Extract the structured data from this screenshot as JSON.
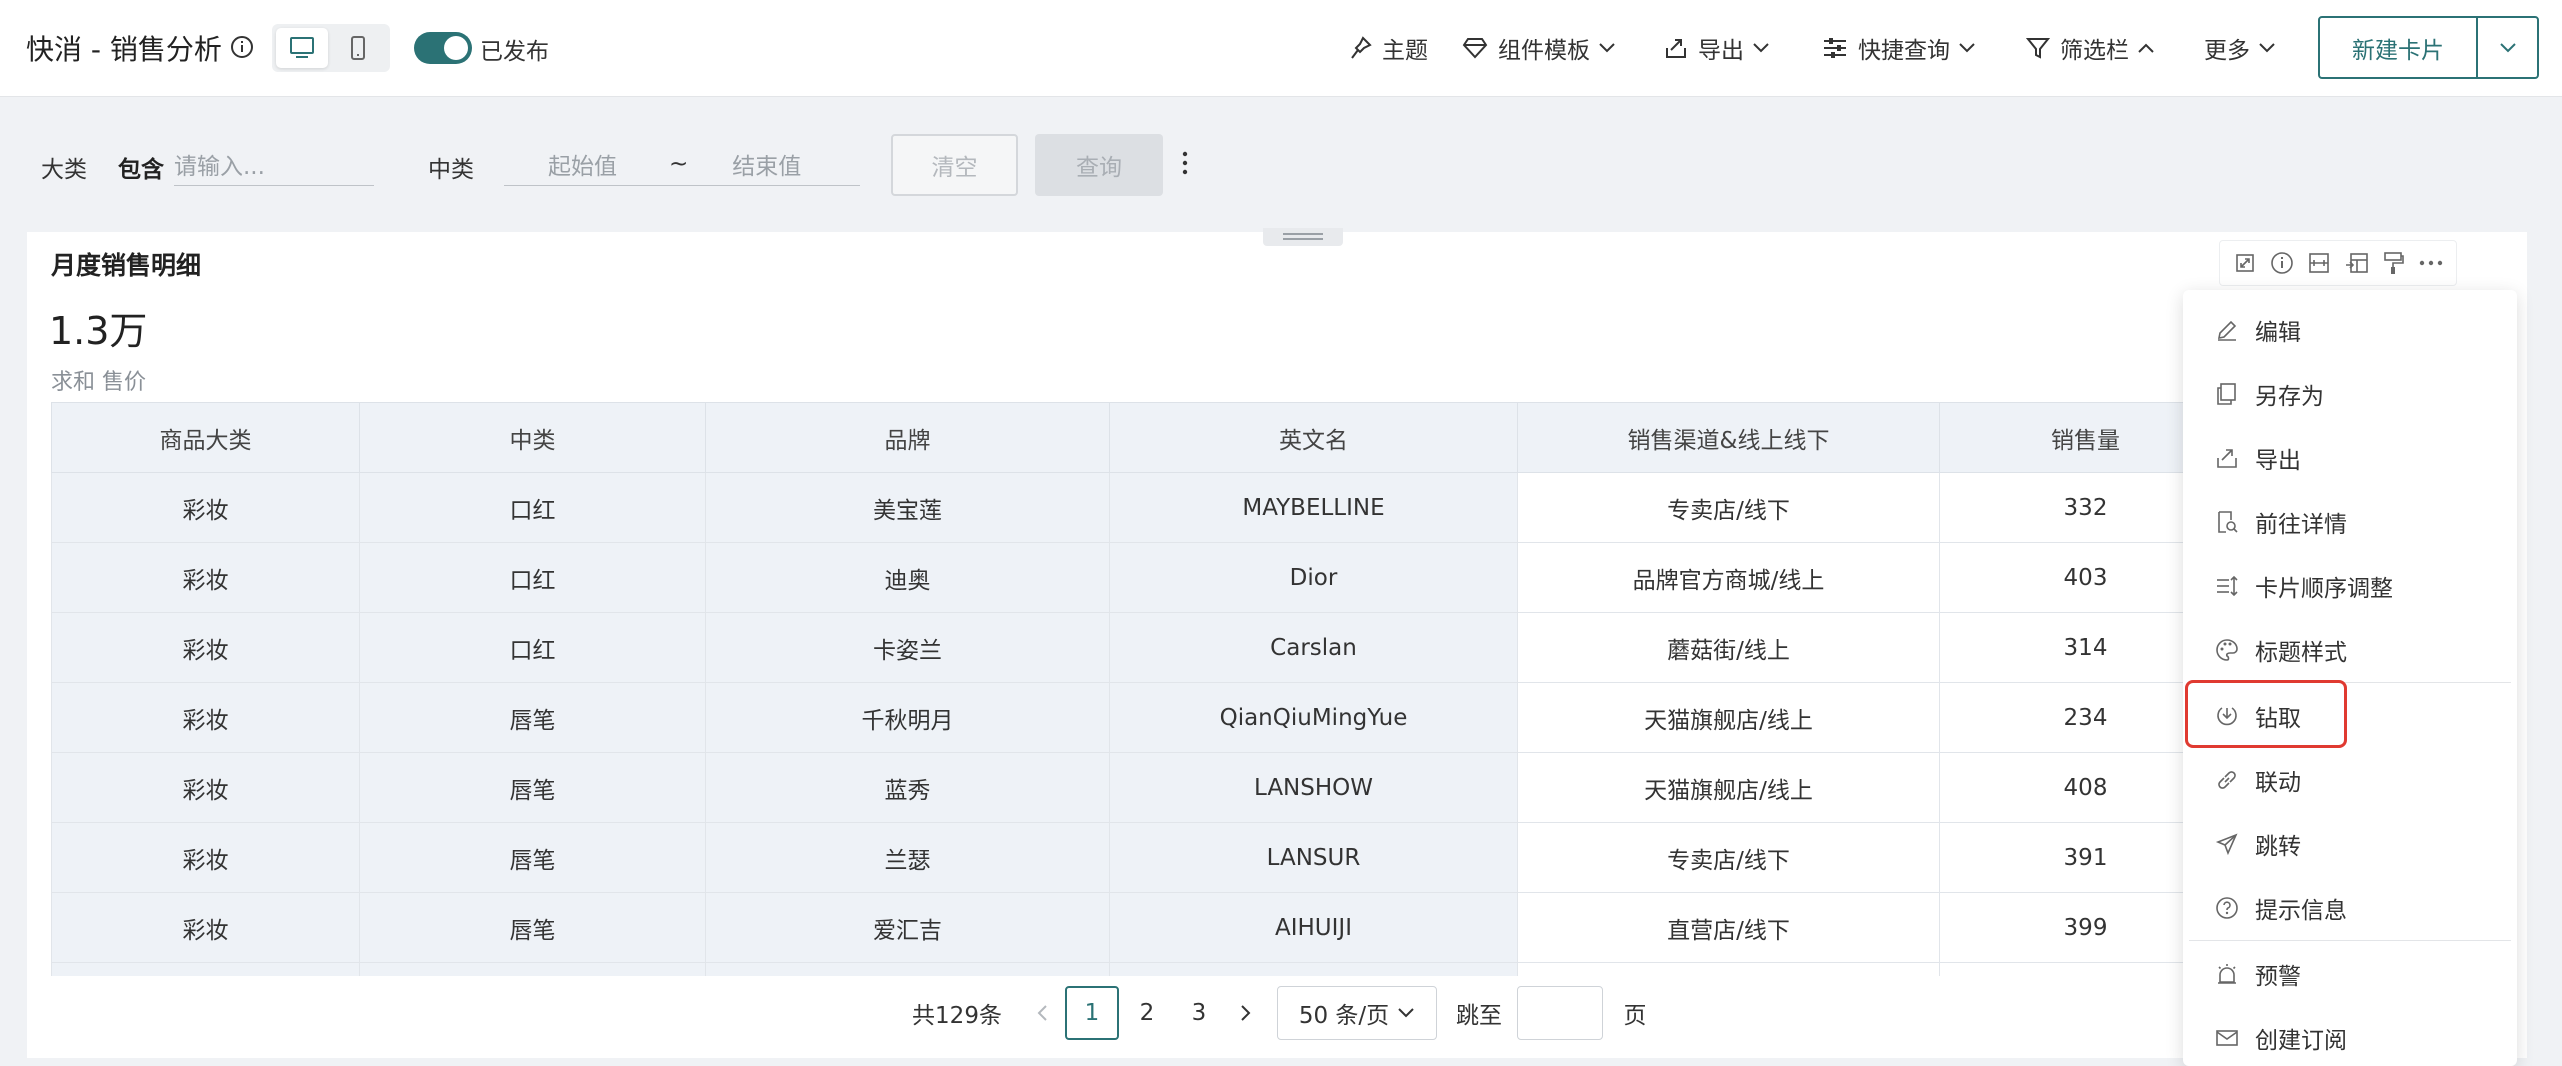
{
  "header": {
    "title": "快消 - 销售分析",
    "publish_label": "已发布",
    "toolbar": {
      "theme": "主题",
      "component_template": "组件模板",
      "export": "导出",
      "quick_query": "快捷查询",
      "filter_bar": "筛选栏",
      "more": "更多"
    },
    "new_card": "新建卡片"
  },
  "filters": {
    "category_label": "大类",
    "category_mode": "包含",
    "category_placeholder": "请输入...",
    "sub_label": "中类",
    "range_start": "起始值",
    "range_sep": "~",
    "range_end": "结束值",
    "clear_button": "清空",
    "query_button": "查询"
  },
  "card": {
    "title": "月度销售明细",
    "value": "1.3万",
    "subtitle": "求和 售价",
    "columns": [
      "商品大类",
      "中类",
      "品牌",
      "英文名",
      "销售渠道&线上线下",
      "销售量"
    ],
    "rows": [
      [
        "彩妆",
        "口红",
        "美宝莲",
        "MAYBELLINE",
        "专卖店/线下",
        "332"
      ],
      [
        "彩妆",
        "口红",
        "迪奥",
        "Dior",
        "品牌官方商城/线上",
        "403"
      ],
      [
        "彩妆",
        "口红",
        "卡姿兰",
        "Carslan",
        "蘑菇街/线上",
        "314"
      ],
      [
        "彩妆",
        "唇笔",
        "千秋明月",
        "QianQiuMingYue",
        "天猫旗舰店/线上",
        "234"
      ],
      [
        "彩妆",
        "唇笔",
        "蓝秀",
        "LANSHOW",
        "天猫旗舰店/线上",
        "408"
      ],
      [
        "彩妆",
        "唇笔",
        "兰瑟",
        "LANSUR",
        "专卖店/线下",
        "391"
      ],
      [
        "彩妆",
        "唇笔",
        "爱汇吉",
        "AIHUIJI",
        "直营店/线下",
        "399"
      ]
    ]
  },
  "pagination": {
    "total": "共129条",
    "pages": [
      "1",
      "2",
      "3"
    ],
    "current_page": "1",
    "page_size": "50 条/页",
    "jump_label": "跳至",
    "page_unit": "页"
  },
  "menu": {
    "items": [
      "编辑",
      "另存为",
      "导出",
      "前往详情",
      "卡片顺序调整",
      "标题样式",
      "钻取",
      "联动",
      "跳转",
      "提示信息",
      "预警",
      "创建订阅"
    ],
    "highlighted": "钻取"
  },
  "colors": {
    "accent": "#2b7275",
    "highlight_border": "#e03a31",
    "table_header_bg": "#eef2f7"
  }
}
